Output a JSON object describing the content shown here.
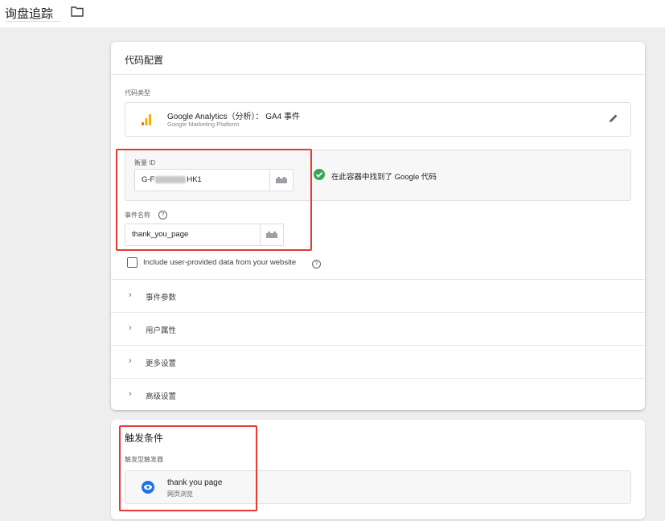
{
  "header": {
    "title": "询盘追踪",
    "folder_icon": "folder-icon"
  },
  "tag_config": {
    "card_title": "代码配置",
    "tag_type_label": "代码类型",
    "tag_type": {
      "icon": "google-analytics-icon",
      "title": "Google Analytics（分析）： GA4 事件",
      "subtitle": "Google Marketing Platform"
    },
    "measurement_id": {
      "label": "衡量 ID",
      "value_prefix": "G-F",
      "value_suffix": "HK1"
    },
    "container_status": "在此容器中找到了 Google 代码",
    "event_name": {
      "label": "事件名称",
      "value": "thank_you_page"
    },
    "include_user_data": {
      "label": "Include user-provided data from your website",
      "checked": false
    },
    "sections": [
      "事件参数",
      "用户属性",
      "更多设置",
      "高级设置"
    ]
  },
  "triggering": {
    "card_title": "触发条件",
    "subtitle": "触发型触发器",
    "trigger": {
      "icon": "eye-icon",
      "name": "thank you page",
      "type": "网页浏览"
    }
  },
  "colors": {
    "accent": "#1a73e8",
    "success": "#34a853",
    "highlight": "#e53935",
    "ga_orange": "#f9ab00",
    "ga_dark": "#e37400"
  }
}
